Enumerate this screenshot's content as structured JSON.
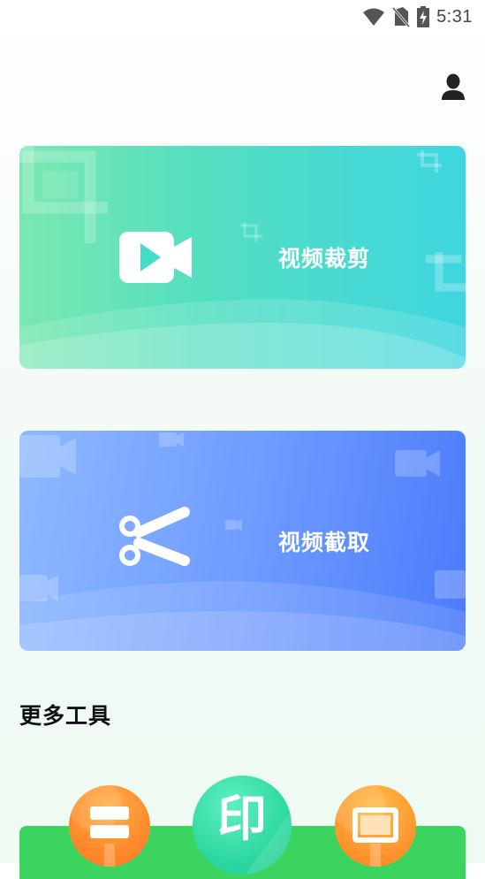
{
  "status_bar": {
    "time": "5:31",
    "icons": [
      "wifi-icon",
      "no-sim-icon",
      "battery-charging-icon"
    ]
  },
  "header": {
    "profile_icon": "user-icon"
  },
  "cards": [
    {
      "label": "视频裁剪",
      "icon": "video-camera-icon",
      "colors": [
        "#7ae8b0",
        "#3fd6e0"
      ]
    },
    {
      "label": "视频截取",
      "icon": "scissors-icon",
      "colors": [
        "#8db9ff",
        "#4b7bfb"
      ]
    }
  ],
  "more_tools": {
    "title": "更多工具",
    "tools": [
      {
        "icon": "layout-icon",
        "color": "#ff8a2b"
      },
      {
        "icon": "stamp-icon",
        "glyph": "印",
        "color": "#2fd8a2"
      },
      {
        "icon": "frame-icon",
        "color": "#ff9830"
      }
    ],
    "bar_color": "#3ad45f"
  }
}
